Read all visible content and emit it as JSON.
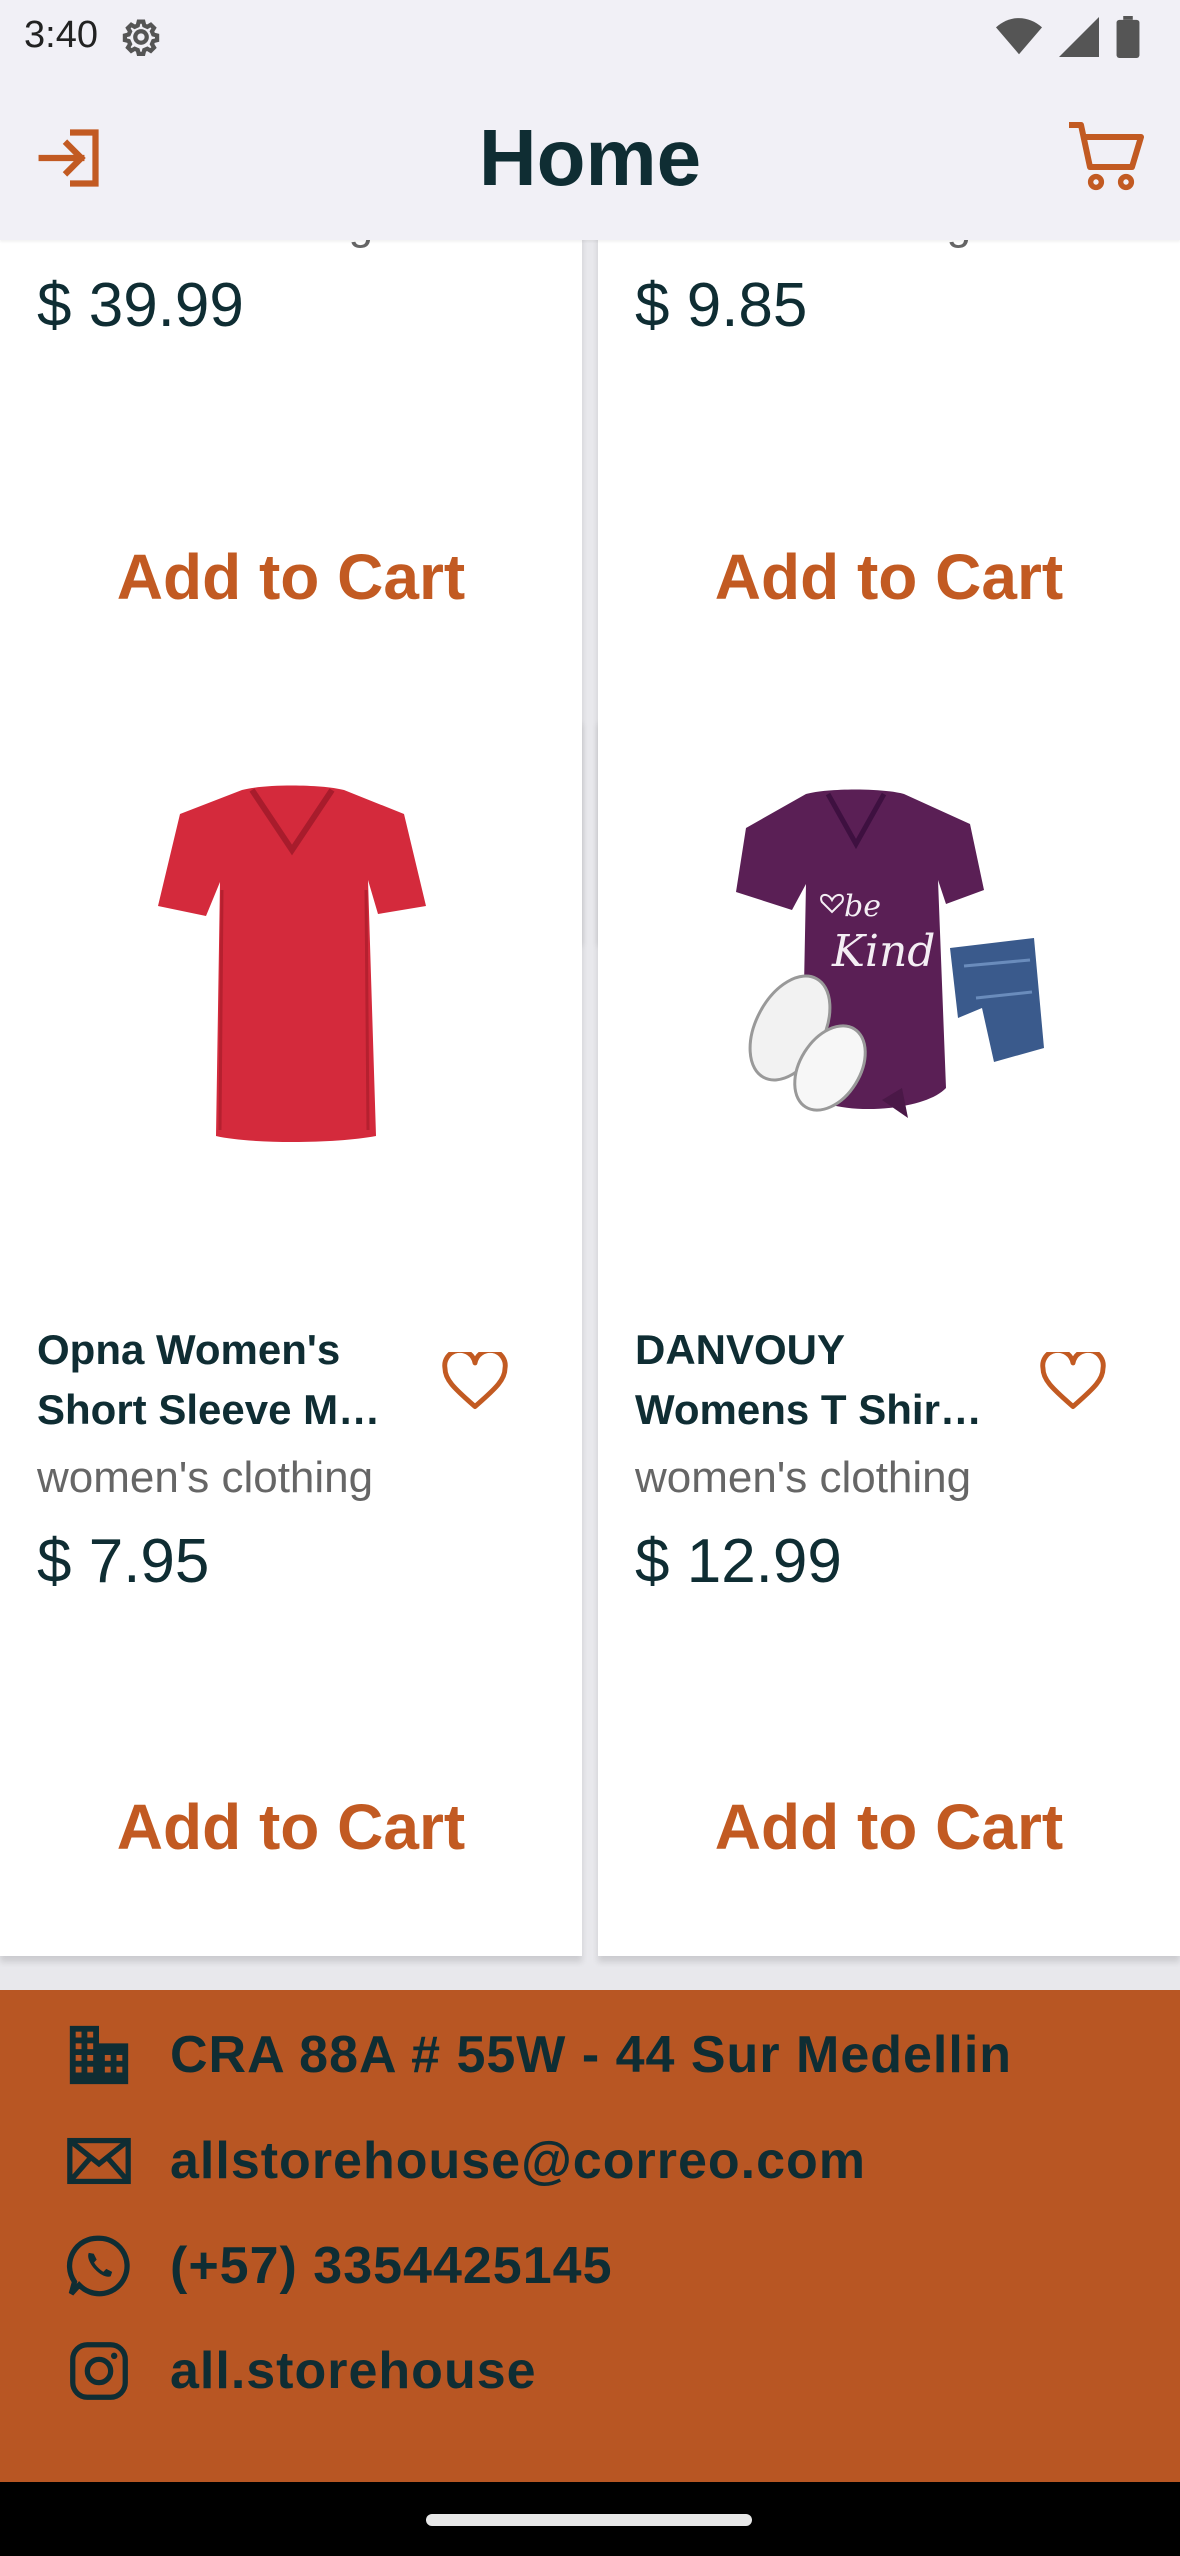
{
  "status_bar": {
    "time": "3:40",
    "icons": [
      "settings-gear-icon",
      "wifi-icon",
      "signal-icon",
      "battery-icon"
    ]
  },
  "app_bar": {
    "title": "Home",
    "left_icon": "login-icon",
    "right_icon": "cart-icon"
  },
  "products_top": [
    {
      "category": "women's clothing",
      "price": "$ 39.99",
      "add_label": "Add to Cart"
    },
    {
      "category": "women's clothing",
      "price": "$ 9.85",
      "add_label": "Add to Cart"
    }
  ],
  "products": [
    {
      "name_line1": "Opna Women's",
      "name_line2": "Short Sleeve M…",
      "category": "women's clothing",
      "price": "$ 7.95",
      "add_label": "Add to Cart",
      "image": "red-vneck-tshirt",
      "favorite_icon": "heart-outline-icon"
    },
    {
      "name_line1": "DANVOUY",
      "name_line2": "Womens T Shir…",
      "category": "women's clothing",
      "price": "$ 12.99",
      "add_label": "Add to Cart",
      "image": "purple-be-kind-tshirt",
      "image_text_1": "be",
      "image_text_2": "Kind",
      "favorite_icon": "heart-outline-icon"
    }
  ],
  "footer": {
    "address": "CRA 88A # 55W - 44 Sur Medellin",
    "email": "allstorehouse@correo.com",
    "phone": "(+57) 3354425145",
    "instagram": "all.storehouse"
  },
  "colors": {
    "accent": "#c25a22",
    "footer_bg": "#b85623",
    "text_dark": "#0f2d33",
    "appbar_bg": "#f1f0f6"
  }
}
